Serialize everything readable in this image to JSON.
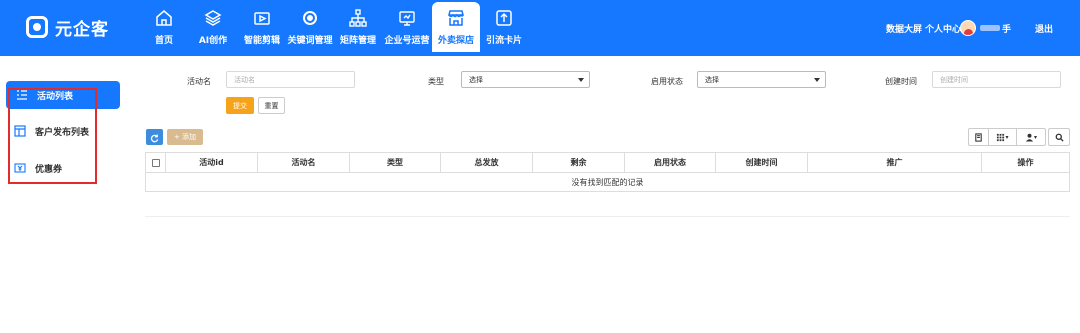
{
  "app": {
    "logo_text": "元企客"
  },
  "nav": [
    {
      "key": "home",
      "label": "首页",
      "icon": "home-icon"
    },
    {
      "key": "ai",
      "label": "AI创作",
      "icon": "layers-icon"
    },
    {
      "key": "clip",
      "label": "智能剪辑",
      "icon": "video-icon"
    },
    {
      "key": "keyword",
      "label": "关键词管理",
      "icon": "target-icon"
    },
    {
      "key": "matrix",
      "label": "矩阵管理",
      "icon": "hierarchy-icon"
    },
    {
      "key": "enterprise",
      "label": "企业号运营",
      "icon": "monitor-icon"
    },
    {
      "key": "takeout",
      "label": "外卖探店",
      "icon": "store-icon",
      "active": true
    },
    {
      "key": "card",
      "label": "引流卡片",
      "icon": "upload-icon"
    }
  ],
  "top_right": {
    "dashboard": "数据大屏",
    "profile": "个人中心",
    "user_suffix": "手",
    "logout": "退出"
  },
  "sidebar": {
    "items": [
      {
        "label": "活动列表",
        "icon": "list-icon",
        "active": true
      },
      {
        "label": "客户发布列表",
        "icon": "table-icon"
      },
      {
        "label": "优惠券",
        "icon": "coupon-icon"
      }
    ]
  },
  "filters": {
    "activity_name": {
      "label": "活动名",
      "placeholder": "活动名"
    },
    "type": {
      "label": "类型",
      "value": "选择"
    },
    "status": {
      "label": "启用状态",
      "value": "选择"
    },
    "created": {
      "label": "创建时间",
      "placeholder": "创建时间"
    },
    "submit": "提交",
    "reset": "重置"
  },
  "toolbar": {
    "add": "+ 添加"
  },
  "table": {
    "columns": [
      "活动id",
      "活动名",
      "类型",
      "总发放",
      "剩余",
      "启用状态",
      "创建时间",
      "推广",
      "操作"
    ],
    "empty_text": "没有找到匹配的记录"
  },
  "colors": {
    "primary": "#1677ff",
    "submit": "#f7a21b",
    "add": "#d9bb8f",
    "highlight": "#e12c2c"
  }
}
